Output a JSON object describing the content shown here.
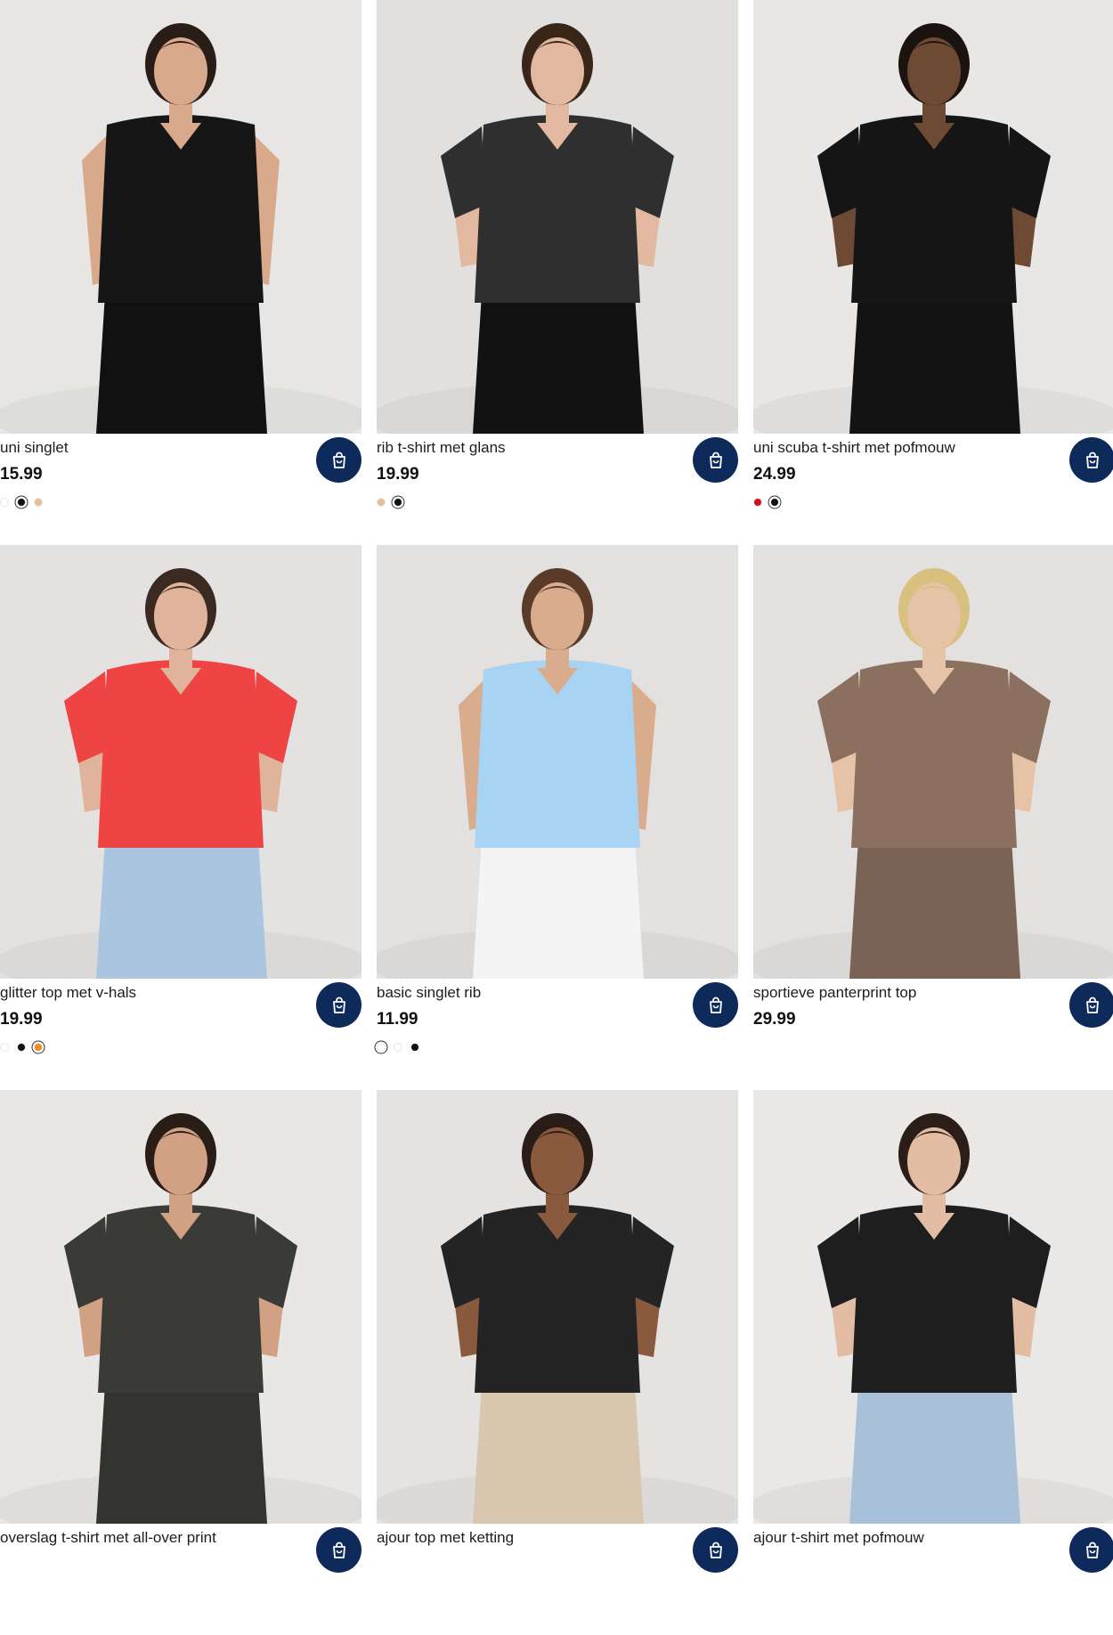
{
  "products": [
    {
      "name": "uni singlet",
      "price": "15.99",
      "swatches": [
        "#ffffff",
        "#111111",
        "#e7bd97"
      ],
      "selected": 1,
      "bg": "#e7e6e4",
      "top": "#161616",
      "bottom": "#111111",
      "skin": "#d8a98a",
      "hair": "#2a1d18",
      "sleeves": false
    },
    {
      "name": "rib t-shirt met glans",
      "price": "19.99",
      "swatches": [
        "#e7bd97",
        "#111111"
      ],
      "selected": 1,
      "bg": "#e1e0de",
      "top": "#2f2f2f",
      "bottom": "#121212",
      "skin": "#e2b8a0",
      "hair": "#3a2619",
      "sleeves": true
    },
    {
      "name": "uni scuba t-shirt met pofmouw",
      "price": "24.99",
      "swatches": [
        "#d40f0f",
        "#111111"
      ],
      "selected": 1,
      "bg": "#e8e7e5",
      "top": "#151515",
      "bottom": "#131313",
      "skin": "#6e4a35",
      "hair": "#1b1310",
      "sleeves": true
    },
    {
      "name": "glitter top met v-hals",
      "price": "19.99",
      "swatches": [
        "#ffffff",
        "#111111",
        "#ef8b1c"
      ],
      "selected": 2,
      "bg": "#e3e2e0",
      "top": "#ef4444",
      "bottom": "#a9c5e0",
      "skin": "#e0b49a",
      "hair": "#3a2a22",
      "sleeves": true
    },
    {
      "name": "basic singlet rib",
      "price": "11.99",
      "swatches": [
        "#ffffff",
        "#ffffff",
        "#111111"
      ],
      "selected": 0,
      "bg": "#e2e1df",
      "top": "#a9d3f2",
      "bottom": "#f4f4f4",
      "skin": "#d9ac8e",
      "hair": "#5a3b2a",
      "sleeves": false
    },
    {
      "name": "sportieve panterprint top",
      "price": "29.99",
      "swatches": [],
      "selected": -1,
      "bg": "#e2e1df",
      "top": "#8b7060",
      "bottom": "#7a6254",
      "skin": "#e6c2a7",
      "hair": "#d8c07e",
      "sleeves": true
    },
    {
      "name": "overslag t-shirt met all-over print",
      "price": "",
      "swatches": [],
      "selected": -1,
      "bg": "#e8e7e5",
      "top": "#3a3a36",
      "bottom": "#33332f",
      "skin": "#d2a083",
      "hair": "#2a1c16",
      "sleeves": true
    },
    {
      "name": "ajour top met ketting",
      "price": "",
      "swatches": [],
      "selected": -1,
      "bg": "#e4e3e1",
      "top": "#242424",
      "bottom": "#d8c7ae",
      "skin": "#8a5a3e",
      "hair": "#2a1d18",
      "sleeves": true
    },
    {
      "name": "ajour t-shirt met pofmouw",
      "price": "",
      "swatches": [],
      "selected": -1,
      "bg": "#e9e8e6",
      "top": "#1e1e1e",
      "bottom": "#a8c0d8",
      "skin": "#e3bca4",
      "hair": "#2b1d17",
      "sleeves": true
    }
  ],
  "colors": {
    "cart_button": "#0e2a5a",
    "cart_icon": "cart-icon"
  }
}
